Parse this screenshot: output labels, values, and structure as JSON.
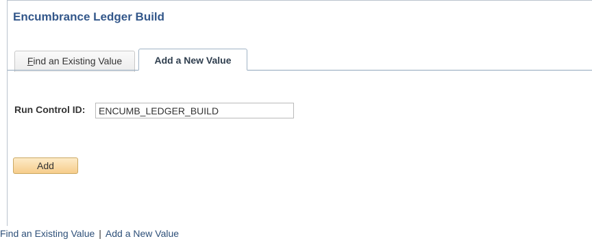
{
  "page": {
    "title": "Encumbrance Ledger Build"
  },
  "tabs": {
    "find_existing": {
      "access_key": "F",
      "label_rest": "ind an Existing Value"
    },
    "add_new": {
      "label": "Add a New Value",
      "selected": true
    }
  },
  "form": {
    "run_control_label": "Run Control ID:",
    "run_control_value": "ENCUMB_LEDGER_BUILD",
    "add_button_label": "Add"
  },
  "footer_links": {
    "find_existing": "Find an Existing Value",
    "separator": "|",
    "add_new": "Add a New Value"
  },
  "colors": {
    "title": "#33578a",
    "link": "#2d4f78",
    "button_top": "#fdebc8",
    "button_bottom": "#f6cd8b"
  }
}
